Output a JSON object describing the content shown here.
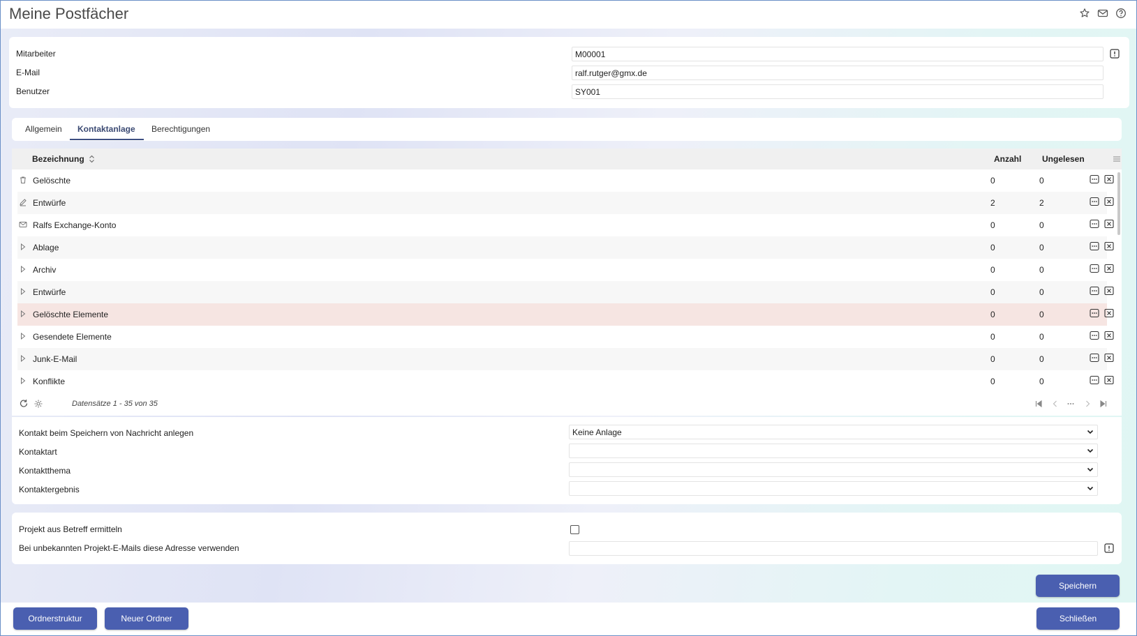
{
  "page": {
    "title": "Meine Postfächer"
  },
  "header_icons": [
    "star-icon",
    "mail-icon",
    "help-icon"
  ],
  "info": {
    "fields": [
      {
        "label": "Mitarbeiter",
        "value": "M00001"
      },
      {
        "label": "E-Mail",
        "value": "ralf.rutger@gmx.de"
      },
      {
        "label": "Benutzer",
        "value": "SY001"
      }
    ]
  },
  "tabs": [
    {
      "label": "Allgemein"
    },
    {
      "label": "Kontaktanlage"
    },
    {
      "label": "Berechtigungen"
    }
  ],
  "active_tab": "Kontaktanlage",
  "grid": {
    "columns": {
      "name": "Bezeichnung",
      "count": "Anzahl",
      "unread": "Ungelesen"
    },
    "rows": [
      {
        "icon": "trash-icon",
        "name": "Gelöschte",
        "count": "0",
        "unread": "0"
      },
      {
        "icon": "pencil-icon",
        "name": "Entwürfe",
        "count": "2",
        "unread": "2"
      },
      {
        "icon": "envelope-icon",
        "name": "Ralfs Exchange-Konto",
        "count": "0",
        "unread": "0"
      },
      {
        "icon": "expand-arrow-icon",
        "name": "Ablage",
        "count": "0",
        "unread": "0"
      },
      {
        "icon": "expand-arrow-icon",
        "name": "Archiv",
        "count": "0",
        "unread": "0"
      },
      {
        "icon": "expand-arrow-icon",
        "name": "Entwürfe",
        "count": "0",
        "unread": "0"
      },
      {
        "icon": "expand-arrow-icon",
        "name": "Gelöschte Elemente",
        "count": "0",
        "unread": "0",
        "selected": true
      },
      {
        "icon": "expand-arrow-icon",
        "name": "Gesendete Elemente",
        "count": "0",
        "unread": "0"
      },
      {
        "icon": "expand-arrow-icon",
        "name": "Junk-E-Mail",
        "count": "0",
        "unread": "0"
      },
      {
        "icon": "expand-arrow-icon",
        "name": "Konflikte",
        "count": "0",
        "unread": "0"
      }
    ],
    "footer_text": "Datensätze 1 - 35 von 35"
  },
  "contact": {
    "fields": [
      {
        "label": "Kontakt beim Speichern von Nachricht anlegen",
        "value": "Keine Anlage"
      },
      {
        "label": "Kontaktart",
        "value": ""
      },
      {
        "label": "Kontaktthema",
        "value": ""
      },
      {
        "label": "Kontaktergebnis",
        "value": ""
      }
    ]
  },
  "project": {
    "subject_label": "Projekt aus Betreff ermitteln",
    "subject_checked": false,
    "address_label": "Bei unbekannten Projekt-E-Mails diese Adresse verwenden",
    "address_value": ""
  },
  "buttons": {
    "save": "Speichern",
    "folder_structure": "Ordnerstruktur",
    "new_folder": "Neuer Ordner",
    "close": "Schließen"
  },
  "colors": {
    "primary_button": "#4a5fb0",
    "selected_row": "#f6e5e2",
    "active_tab": "#3d4f82"
  }
}
